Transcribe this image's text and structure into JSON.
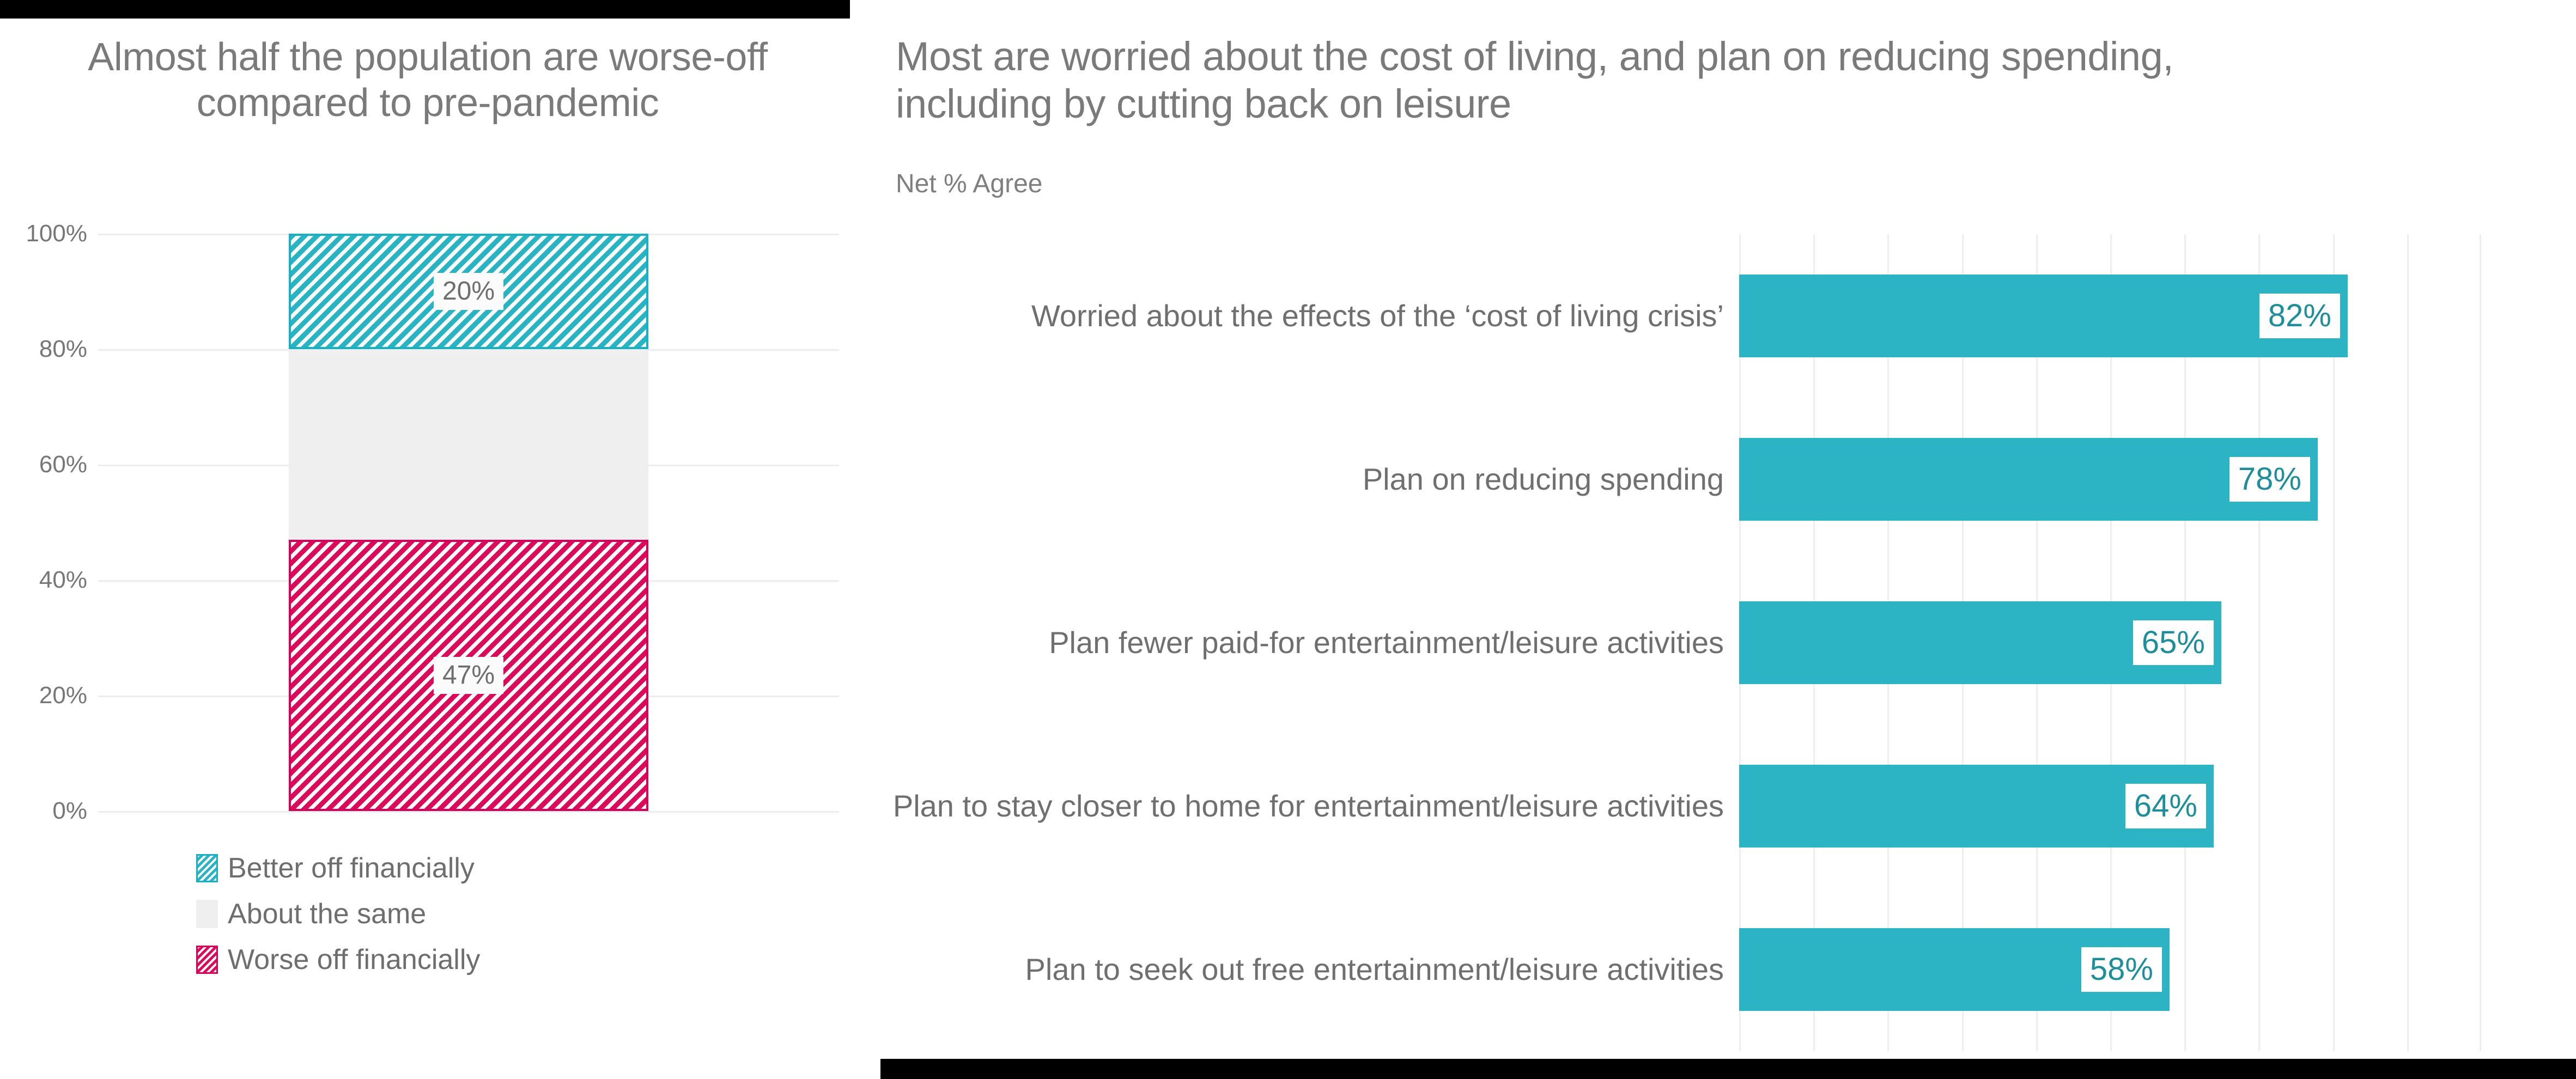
{
  "left": {
    "title": "Almost half the population are worse-off compared to pre-pandemic",
    "legend": [
      {
        "label": "Better off financially",
        "swatch": "teal-hatched"
      },
      {
        "label": "About the same",
        "swatch": "grey-solid"
      },
      {
        "label": "Worse off financially",
        "swatch": "pink-hatched"
      }
    ]
  },
  "right": {
    "title": "Most are worried about the cost of living, and plan on reducing spending, including by cutting back on leisure",
    "subtitle": "Net % Agree"
  },
  "colors": {
    "teal": "#2CB4C4",
    "teal_hatch_border": "#18B0C4",
    "pink": "#DC0A5A",
    "pink_hatch_border": "#D4005A",
    "grey_segment": "#EFEFEF",
    "gridline": "#EEEEEE",
    "text_grey": "#7A7A7A",
    "value_text_teal": "#1F8E9C",
    "black_band": "#000000"
  },
  "chart_data": [
    {
      "type": "bar",
      "subtype": "stacked-column-100pct",
      "title": "Almost half the population are worse-off compared to pre-pandemic",
      "xlabel": "",
      "ylabel": "",
      "ylim": [
        0,
        100
      ],
      "yticks": [
        "0%",
        "20%",
        "40%",
        "60%",
        "80%",
        "100%"
      ],
      "ytick_values": [
        0,
        20,
        40,
        60,
        80,
        100
      ],
      "grid": "horizontal",
      "legend_position": "bottom-left",
      "categories": [
        ""
      ],
      "series": [
        {
          "name": "Worse off financially",
          "values": [
            47
          ],
          "label": "47%",
          "color": "#DC0A5A",
          "pattern": "diagonal-hatch",
          "stack_from": 0,
          "stack_to": 47
        },
        {
          "name": "About the same",
          "values": [
            33
          ],
          "label": "",
          "color": "#EFEFEF",
          "pattern": "solid",
          "stack_from": 47,
          "stack_to": 80
        },
        {
          "name": "Better off financially",
          "values": [
            20
          ],
          "label": "20%",
          "color": "#2CB4C4",
          "pattern": "diagonal-hatch",
          "stack_from": 80,
          "stack_to": 100
        }
      ]
    },
    {
      "type": "bar",
      "subtype": "horizontal-bar",
      "title": "Most are worried about the cost of living, and plan on reducing spending, including by cutting back on leisure",
      "subtitle": "Net % Agree",
      "xlabel": "",
      "ylabel": "",
      "xlim": [
        0,
        100
      ],
      "grid": "vertical",
      "gridline_count": 11,
      "legend_position": "none",
      "categories": [
        "Worried about the effects of the ‘cost of living crisis’",
        "Plan on reducing spending",
        "Plan fewer paid-for entertainment/leisure activities",
        "Plan to stay closer to home for entertainment/leisure activities",
        "Plan to seek out free entertainment/leisure activities"
      ],
      "values": [
        82,
        78,
        65,
        64,
        58
      ],
      "value_labels": [
        "82%",
        "78%",
        "65%",
        "64%",
        "58%"
      ],
      "color": "#2CB4C4"
    }
  ]
}
